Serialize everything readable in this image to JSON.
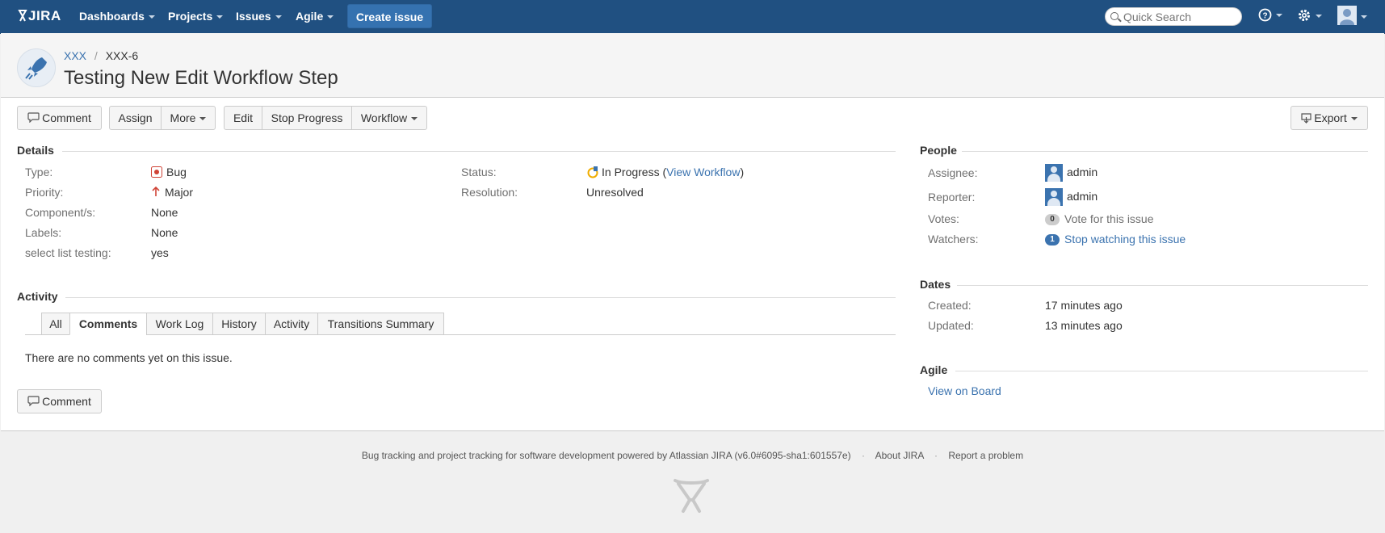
{
  "header": {
    "logo": "JIRA",
    "nav": [
      {
        "label": "Dashboards"
      },
      {
        "label": "Projects"
      },
      {
        "label": "Issues"
      },
      {
        "label": "Agile"
      }
    ],
    "create_label": "Create issue",
    "search_placeholder": "Quick Search"
  },
  "breadcrumb": {
    "project": "XXX",
    "separator": "/",
    "issue_key": "XXX-6"
  },
  "issue": {
    "summary": "Testing New Edit Workflow Step"
  },
  "toolbar": {
    "comment": "Comment",
    "assign": "Assign",
    "more": "More",
    "edit": "Edit",
    "stop_progress": "Stop Progress",
    "workflow": "Workflow",
    "export": "Export"
  },
  "details": {
    "title": "Details",
    "fields": [
      {
        "label": "Type:",
        "value": "Bug"
      },
      {
        "label": "Priority:",
        "value": "Major"
      },
      {
        "label": "Component/s:",
        "value": "None"
      },
      {
        "label": "Labels:",
        "value": "None"
      },
      {
        "label": "select list testing:",
        "value": "yes"
      }
    ],
    "status_label": "Status:",
    "status_value": "In Progress",
    "status_link": "View Workflow",
    "resolution_label": "Resolution:",
    "resolution_value": "Unresolved"
  },
  "activity": {
    "title": "Activity",
    "tabs": [
      "All",
      "Comments",
      "Work Log",
      "History",
      "Activity",
      "Transitions Summary"
    ],
    "active_tab": "Comments",
    "empty_text": "There are no comments yet on this issue.",
    "comment_button": "Comment"
  },
  "people": {
    "title": "People",
    "assignee_label": "Assignee:",
    "assignee": "admin",
    "reporter_label": "Reporter:",
    "reporter": "admin",
    "votes_label": "Votes:",
    "votes_count": "0",
    "votes_link": "Vote for this issue",
    "watchers_label": "Watchers:",
    "watchers_count": "1",
    "watchers_link": "Stop watching this issue"
  },
  "dates": {
    "title": "Dates",
    "created_label": "Created:",
    "created": "17 minutes ago",
    "updated_label": "Updated:",
    "updated": "13 minutes ago"
  },
  "agile": {
    "title": "Agile",
    "link": "View on Board"
  },
  "footer": {
    "powered_by": "Bug tracking and project tracking for software development powered by Atlassian JIRA (v6.0#6095-sha1:601557e)",
    "about": "About JIRA",
    "report": "Report a problem",
    "separator": "·"
  },
  "colors": {
    "header_bg": "#205081",
    "link": "#3b73af",
    "create_button": "#3572b0",
    "bug_icon": "#d04437",
    "priority_major": "#d04437"
  }
}
